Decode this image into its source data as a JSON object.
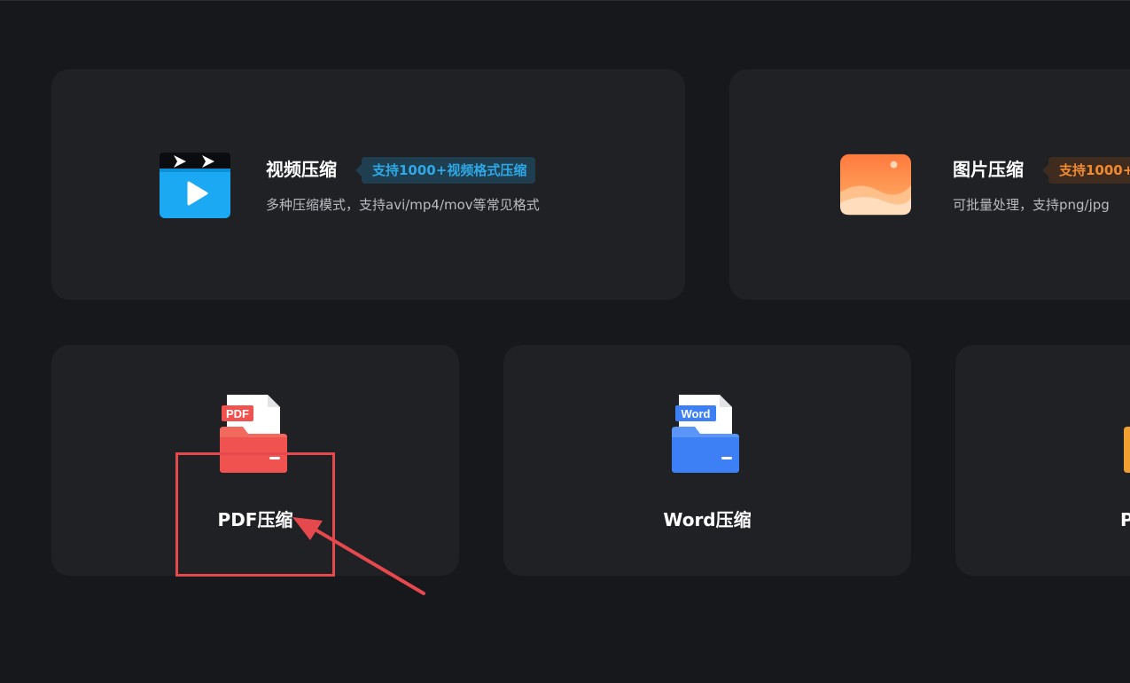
{
  "cards": {
    "video": {
      "title": "视频压缩",
      "badge": "支持1000+视频格式压缩",
      "description": "多种压缩模式，支持avi/mp4/mov等常见格式",
      "icon": "video-clapper-icon",
      "accent": "#2ea8e6"
    },
    "image": {
      "title": "图片压缩",
      "badge": "支持1000+",
      "description": "可批量处理，支持png/jpg",
      "icon": "image-landscape-icon",
      "accent": "#f08a30"
    },
    "pdf": {
      "label": "PDF压缩",
      "icon_text": "PDF",
      "icon": "pdf-folder-icon",
      "accent": "#f0534f"
    },
    "word": {
      "label": "Word压缩",
      "icon_text": "Word",
      "icon": "word-folder-icon",
      "accent": "#3d7ff5"
    },
    "ppt": {
      "label": "P",
      "icon": "ppt-folder-icon",
      "accent": "#f0a030"
    }
  },
  "annotation": {
    "color": "#e5484d"
  }
}
